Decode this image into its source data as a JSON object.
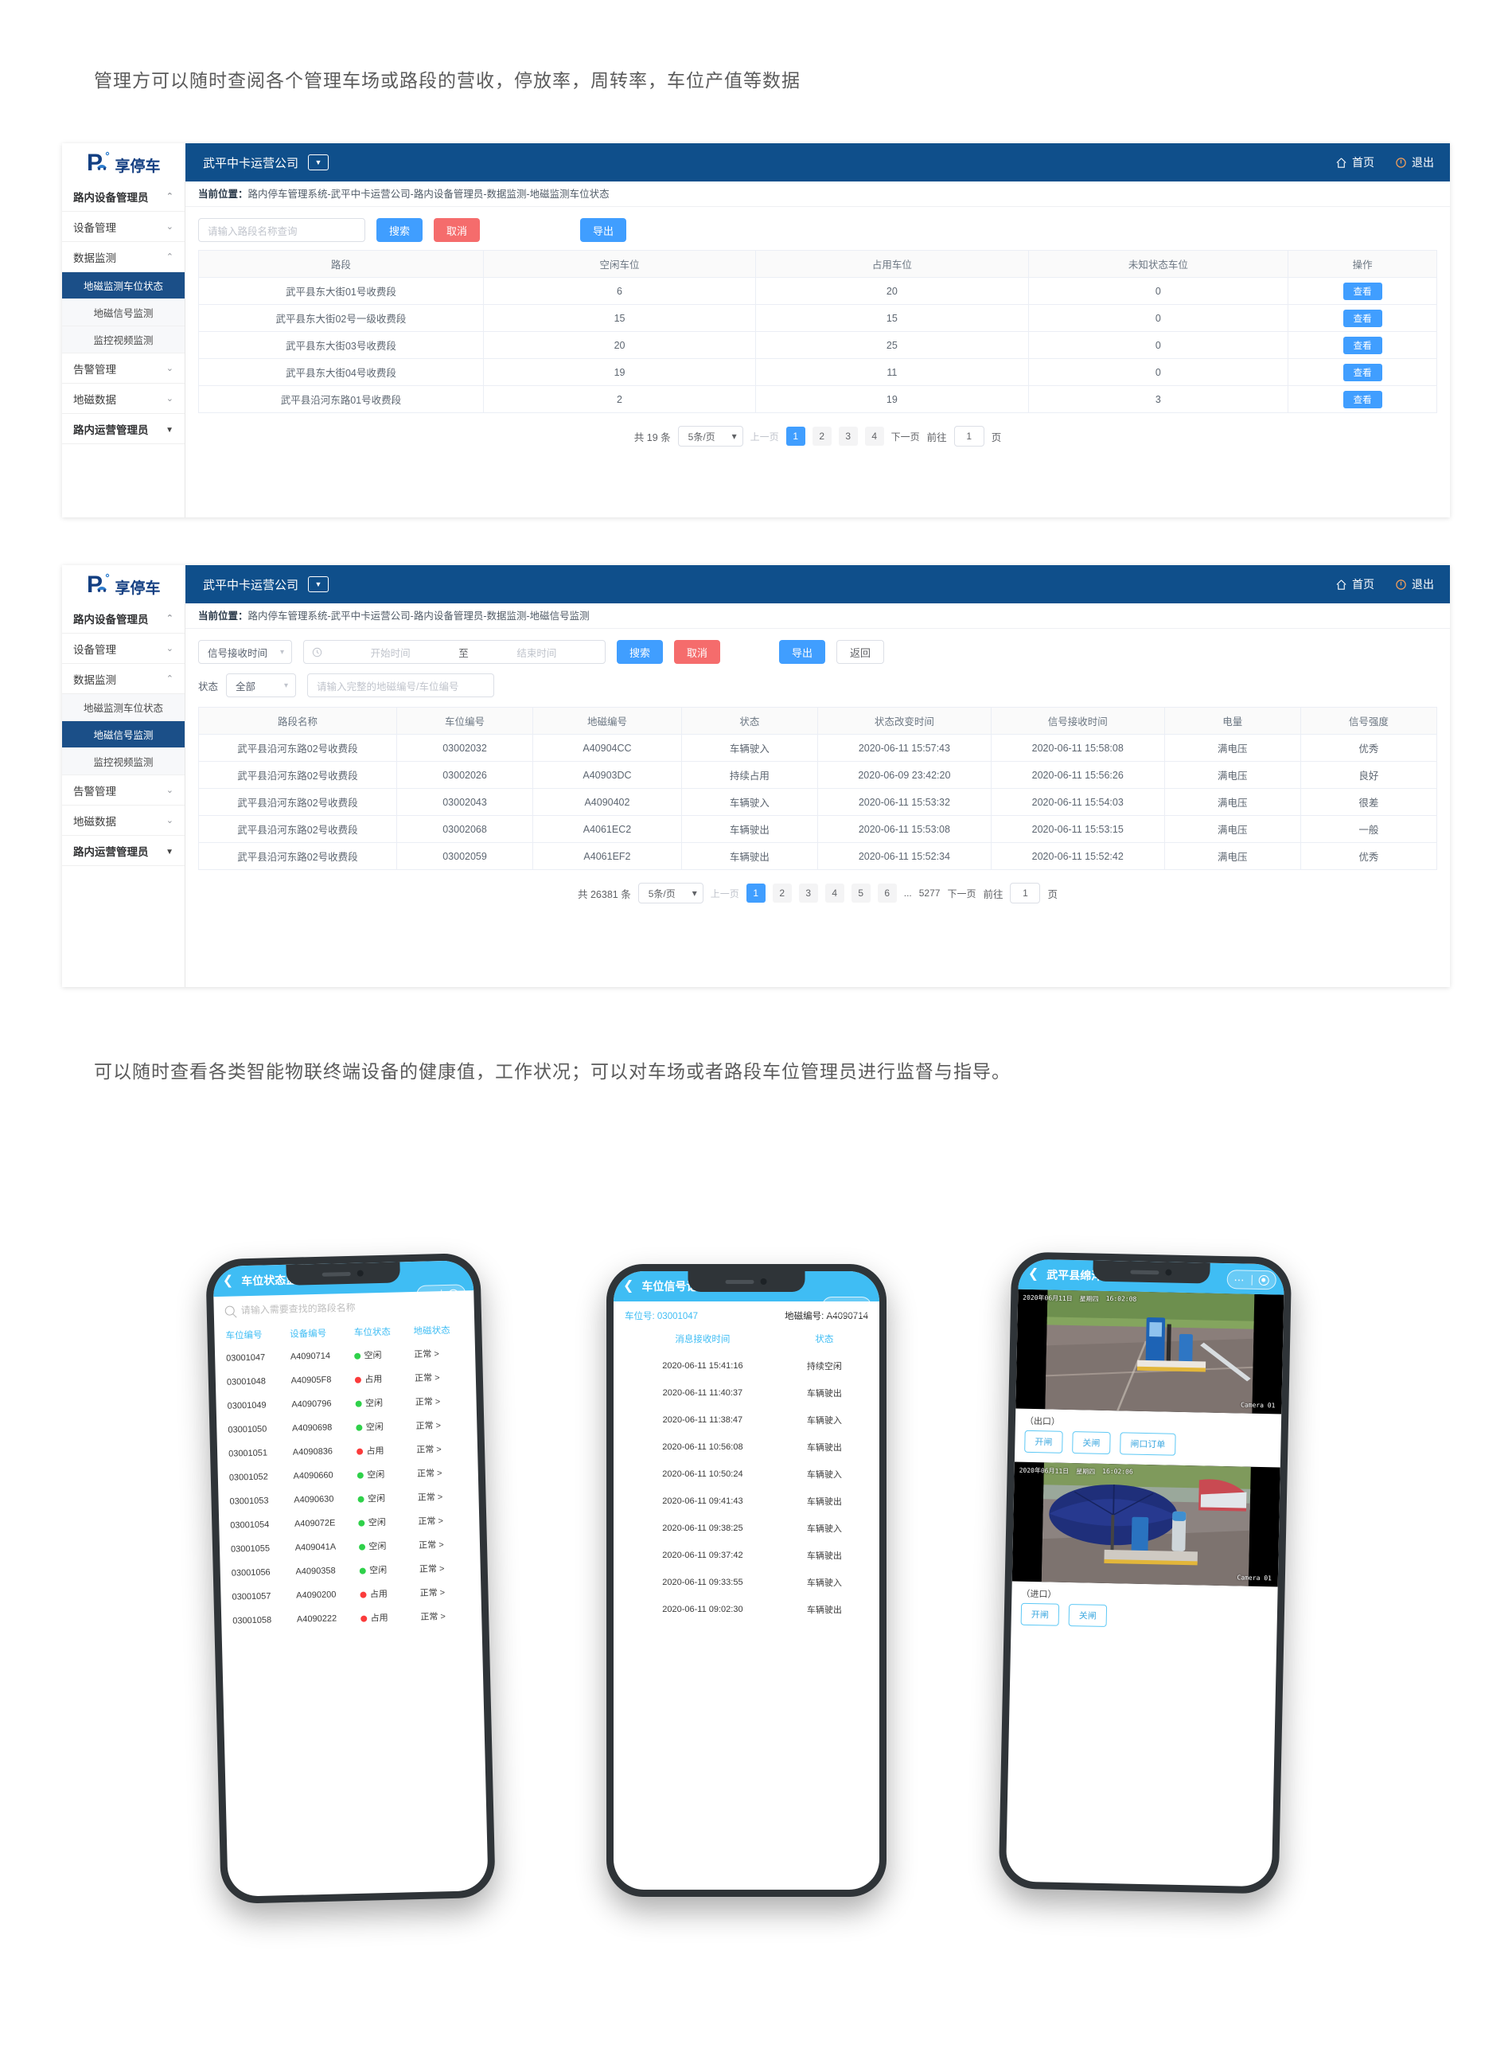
{
  "captions": {
    "top": "管理方可以随时查阅各个管理车场或路段的营收，停放率，周转率，车位产值等数据",
    "middle": "可以随时查看各类智能物联终端设备的健康值，工作状况；可以对车场或者路段车位管理员进行监督与指导。"
  },
  "brand": {
    "logo_text": "享停车",
    "logo_letter": "P"
  },
  "topbar": {
    "company": "武平中卡运营公司",
    "home_label": "首页",
    "exit_label": "退出",
    "home_icon": "home-icon",
    "exit_icon": "exit-icon",
    "caret_icon": "caret-down-icon",
    "bg_color": "#0f4f8b"
  },
  "panel1": {
    "breadcrumb_prefix": "当前位置：",
    "breadcrumb": "路内停车管理系统-武平中卡运营公司-路内设备管理员-数据监测-地磁监测车位状态",
    "sidebar": {
      "role": "路内设备管理员",
      "groups": [
        {
          "label": "设备管理",
          "state": "collapsed"
        },
        {
          "label": "数据监测",
          "state": "expanded"
        }
      ],
      "items": [
        {
          "label": "地磁监测车位状态",
          "active": true
        },
        {
          "label": "地磁信号监测",
          "active": false
        },
        {
          "label": "监控视频监测",
          "active": false
        }
      ],
      "groups2": [
        {
          "label": "告警管理",
          "state": "collapsed"
        },
        {
          "label": "地磁数据",
          "state": "collapsed"
        }
      ],
      "role2": "路内运营管理员"
    },
    "toolbar": {
      "search_placeholder": "请输入路段名称查询",
      "search_label": "搜索",
      "cancel_label": "取消",
      "export_label": "导出"
    },
    "table": {
      "headers": [
        "路段",
        "空闲车位",
        "占用车位",
        "未知状态车位",
        "操作"
      ],
      "action_label": "查看",
      "rows": [
        {
          "road": "武平县东大街01号收费段",
          "free": "6",
          "used": "20",
          "unknown": "0"
        },
        {
          "road": "武平县东大街02号一级收费段",
          "free": "15",
          "used": "15",
          "unknown": "0"
        },
        {
          "road": "武平县东大街03号收费段",
          "free": "20",
          "used": "25",
          "unknown": "0"
        },
        {
          "road": "武平县东大街04号收费段",
          "free": "19",
          "used": "11",
          "unknown": "0"
        },
        {
          "road": "武平县沿河东路01号收费段",
          "free": "2",
          "used": "19",
          "unknown": "3"
        }
      ]
    },
    "pager": {
      "total": "共 19 条",
      "page_size": "5条/页",
      "prev": "上一页",
      "next": "下一页",
      "pages": [
        "1",
        "2",
        "3",
        "4"
      ],
      "active_page": "1",
      "goto_label": "前往",
      "goto_value": "1",
      "page_unit": "页"
    }
  },
  "panel2": {
    "breadcrumb_prefix": "当前位置：",
    "breadcrumb": "路内停车管理系统-武平中卡运营公司-路内设备管理员-数据监测-地磁信号监测",
    "sidebar": {
      "role": "路内设备管理员",
      "groups": [
        {
          "label": "设备管理",
          "state": "collapsed"
        },
        {
          "label": "数据监测",
          "state": "expanded"
        }
      ],
      "items": [
        {
          "label": "地磁监测车位状态",
          "active": false
        },
        {
          "label": "地磁信号监测",
          "active": true
        },
        {
          "label": "监控视频监测",
          "active": false
        }
      ],
      "groups2": [
        {
          "label": "告警管理",
          "state": "collapsed"
        },
        {
          "label": "地磁数据",
          "state": "collapsed"
        }
      ],
      "role2": "路内运营管理员"
    },
    "toolbar": {
      "time_field": "信号接收时间",
      "start_placeholder": "开始时间",
      "range_sep": "至",
      "end_placeholder": "结束时间",
      "search_label": "搜索",
      "cancel_label": "取消",
      "export_label": "导出",
      "back_label": "返回",
      "status_label": "状态",
      "status_value": "全部",
      "code_placeholder": "请输入完整的地磁编号/车位编号"
    },
    "table": {
      "headers": [
        "路段名称",
        "车位编号",
        "地磁编号",
        "状态",
        "状态改变时间",
        "信号接收时间",
        "电量",
        "信号强度"
      ],
      "rows": [
        {
          "road": "武平县沿河东路02号收费段",
          "slot": "03002032",
          "device": "A40904CC",
          "status": "车辆驶入",
          "change_time": "2020-06-11 15:57:43",
          "recv_time": "2020-06-11 15:58:08",
          "battery": "满电压",
          "signal": "优秀"
        },
        {
          "road": "武平县沿河东路02号收费段",
          "slot": "03002026",
          "device": "A40903DC",
          "status": "持续占用",
          "change_time": "2020-06-09 23:42:20",
          "recv_time": "2020-06-11 15:56:26",
          "battery": "满电压",
          "signal": "良好"
        },
        {
          "road": "武平县沿河东路02号收费段",
          "slot": "03002043",
          "device": "A4090402",
          "status": "车辆驶入",
          "change_time": "2020-06-11 15:53:32",
          "recv_time": "2020-06-11 15:54:03",
          "battery": "满电压",
          "signal": "很差"
        },
        {
          "road": "武平县沿河东路02号收费段",
          "slot": "03002068",
          "device": "A4061EC2",
          "status": "车辆驶出",
          "change_time": "2020-06-11 15:53:08",
          "recv_time": "2020-06-11 15:53:15",
          "battery": "满电压",
          "signal": "一般"
        },
        {
          "road": "武平县沿河东路02号收费段",
          "slot": "03002059",
          "device": "A4061EF2",
          "status": "车辆驶出",
          "change_time": "2020-06-11 15:52:34",
          "recv_time": "2020-06-11 15:52:42",
          "battery": "满电压",
          "signal": "优秀"
        }
      ]
    },
    "pager": {
      "total": "共 26381 条",
      "page_size": "5条/页",
      "prev": "上一页",
      "next": "下一页",
      "pages": [
        "1",
        "2",
        "3",
        "4",
        "5",
        "6"
      ],
      "ellipsis": "...",
      "last_page": "5277",
      "active_page": "1",
      "goto_label": "前往",
      "goto_value": "1",
      "page_unit": "页"
    }
  },
  "phone1": {
    "title": "车位状态监测",
    "back_icon": "back-chevron-icon",
    "search_placeholder": "请输入需要查找的路段名称",
    "search_icon": "search-icon",
    "headers": [
      "车位编号",
      "设备编号",
      "车位状态",
      "地磁状态"
    ],
    "rows": [
      {
        "slot": "03001047",
        "device": "A4090714",
        "state": "空闲",
        "state_color": "green",
        "magnetic": "正常 >"
      },
      {
        "slot": "03001048",
        "device": "A40905F8",
        "state": "占用",
        "state_color": "red",
        "magnetic": "正常 >"
      },
      {
        "slot": "03001049",
        "device": "A4090796",
        "state": "空闲",
        "state_color": "green",
        "magnetic": "正常 >"
      },
      {
        "slot": "03001050",
        "device": "A4090698",
        "state": "空闲",
        "state_color": "green",
        "magnetic": "正常 >"
      },
      {
        "slot": "03001051",
        "device": "A4090836",
        "state": "占用",
        "state_color": "red",
        "magnetic": "正常 >"
      },
      {
        "slot": "03001052",
        "device": "A4090660",
        "state": "空闲",
        "state_color": "green",
        "magnetic": "正常 >"
      },
      {
        "slot": "03001053",
        "device": "A4090630",
        "state": "空闲",
        "state_color": "green",
        "magnetic": "正常 >"
      },
      {
        "slot": "03001054",
        "device": "A409072E",
        "state": "空闲",
        "state_color": "green",
        "magnetic": "正常 >"
      },
      {
        "slot": "03001055",
        "device": "A409041A",
        "state": "空闲",
        "state_color": "green",
        "magnetic": "正常 >"
      },
      {
        "slot": "03001056",
        "device": "A4090358",
        "state": "空闲",
        "state_color": "green",
        "magnetic": "正常 >"
      },
      {
        "slot": "03001057",
        "device": "A4090200",
        "state": "占用",
        "state_color": "red",
        "magnetic": "正常 >"
      },
      {
        "slot": "03001058",
        "device": "A4090222",
        "state": "占用",
        "state_color": "red",
        "magnetic": "正常 >"
      }
    ]
  },
  "phone2": {
    "title": "车位信号记录",
    "back_icon": "back-chevron-icon",
    "slot_label": "车位号:",
    "slot_value": "03001047",
    "device_label": "地磁编号:",
    "device_value": "A4090714",
    "headers": [
      "消息接收时间",
      "状态"
    ],
    "rows": [
      {
        "time": "2020-06-11 15:41:16",
        "status": "持续空闲"
      },
      {
        "time": "2020-06-11 11:40:37",
        "status": "车辆驶出"
      },
      {
        "time": "2020-06-11 11:38:47",
        "status": "车辆驶入"
      },
      {
        "time": "2020-06-11 10:56:08",
        "status": "车辆驶出"
      },
      {
        "time": "2020-06-11 10:50:24",
        "status": "车辆驶入"
      },
      {
        "time": "2020-06-11 09:41:43",
        "status": "车辆驶出"
      },
      {
        "time": "2020-06-11 09:38:25",
        "status": "车辆驶入"
      },
      {
        "time": "2020-06-11 09:37:42",
        "status": "车辆驶出"
      },
      {
        "time": "2020-06-11 09:33:55",
        "status": "车辆驶入"
      },
      {
        "time": "2020-06-11 09:02:30",
        "status": "车辆驶出"
      }
    ]
  },
  "phone3": {
    "title": "武平县绵洋寺停车场",
    "back_icon": "back-chevron-icon",
    "cameras": [
      {
        "osd_date": "2020年06月11日",
        "osd_week": "星期四",
        "osd_time": "16:02:08",
        "osd_name": "Camera 01",
        "caption": "（出口）",
        "buttons": [
          "开闸",
          "关闸",
          "闸口订单"
        ]
      },
      {
        "osd_date": "2020年06月11日",
        "osd_week": "星期四",
        "osd_time": "16:02:06",
        "osd_name": "Camera 01",
        "caption": "（进口）",
        "buttons": [
          "开闸",
          "关闸"
        ]
      }
    ]
  },
  "colors": {
    "header_blue": "#0f4f8b",
    "primary_blue": "#409eff",
    "danger_red": "#f56c6c",
    "app_cyan": "#3fbdf4",
    "active_nav": "#1b4f88"
  }
}
